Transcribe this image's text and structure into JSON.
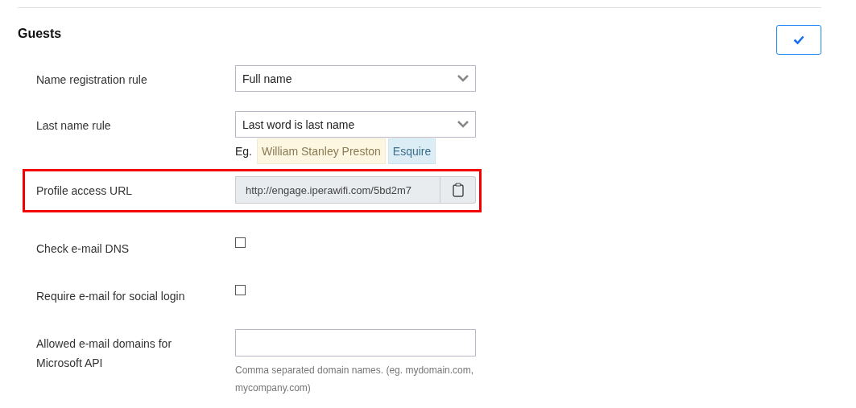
{
  "section": {
    "title": "Guests"
  },
  "rows": [
    {
      "kind": "select",
      "label": "Name registration rule",
      "value": "Full name",
      "highlighted": false
    },
    {
      "kind": "select",
      "label": "Last name rule",
      "value": "Last word is last name",
      "highlighted": false,
      "example": {
        "prefix": "Eg.",
        "first": "William Stanley Preston",
        "last": "Esquire"
      }
    },
    {
      "kind": "url",
      "label": "Profile access URL",
      "value": "http://engage.iperawifi.com/5bd2m7",
      "highlighted": true
    },
    {
      "kind": "checkbox",
      "label": "Check e-mail DNS",
      "checked": false,
      "highlighted": false
    },
    {
      "kind": "checkbox",
      "label": "Require e-mail for social login",
      "checked": false,
      "highlighted": false
    },
    {
      "kind": "text",
      "label": "Allowed e-mail domains for Microsoft API",
      "help": "Comma separated domain names. (eg. mydomain.com, mycompany.com)",
      "highlighted": false
    }
  ]
}
